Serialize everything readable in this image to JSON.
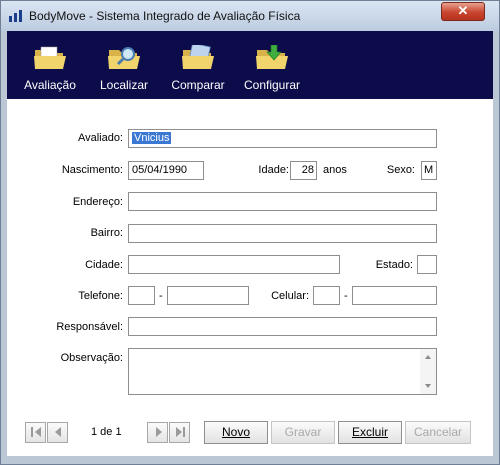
{
  "window": {
    "title": "BodyMove - Sistema Integrado de Avaliação Física",
    "close_glyph": "✕"
  },
  "toolbar": {
    "avaliacao": "Avaliação",
    "localizar": "Localizar",
    "comparar": "Comparar",
    "configurar": "Configurar"
  },
  "form": {
    "avaliado_label": "Avaliado:",
    "avaliado_value": "Vnicius",
    "nascimento_label": "Nascimento:",
    "nascimento_value": "05/04/1990",
    "idade_label": "Idade:",
    "idade_value": "28",
    "anos_label": "anos",
    "sexo_label": "Sexo:",
    "sexo_value": "M",
    "endereco_label": "Endereço:",
    "endereco_value": "",
    "bairro_label": "Bairro:",
    "bairro_value": "",
    "cidade_label": "Cidade:",
    "cidade_value": "",
    "estado_label": "Estado:",
    "estado_value": "",
    "telefone_label": "Telefone:",
    "telefone_ddd": "",
    "telefone_sep": "-",
    "telefone_num": "",
    "celular_label": "Celular:",
    "celular_ddd": "",
    "celular_sep": "-",
    "celular_num": "",
    "responsavel_label": "Responsável:",
    "responsavel_value": "",
    "observacao_label": "Observação:",
    "observacao_value": ""
  },
  "navigator": {
    "record_text": "1 de 1"
  },
  "buttons": {
    "novo": "Novo",
    "gravar": "Gravar",
    "excluir": "Excluir",
    "cancelar": "Cancelar"
  },
  "colors": {
    "toolbar_bg": "#0c0c4a",
    "selection": "#3a78d4",
    "close": "#c8452f"
  }
}
